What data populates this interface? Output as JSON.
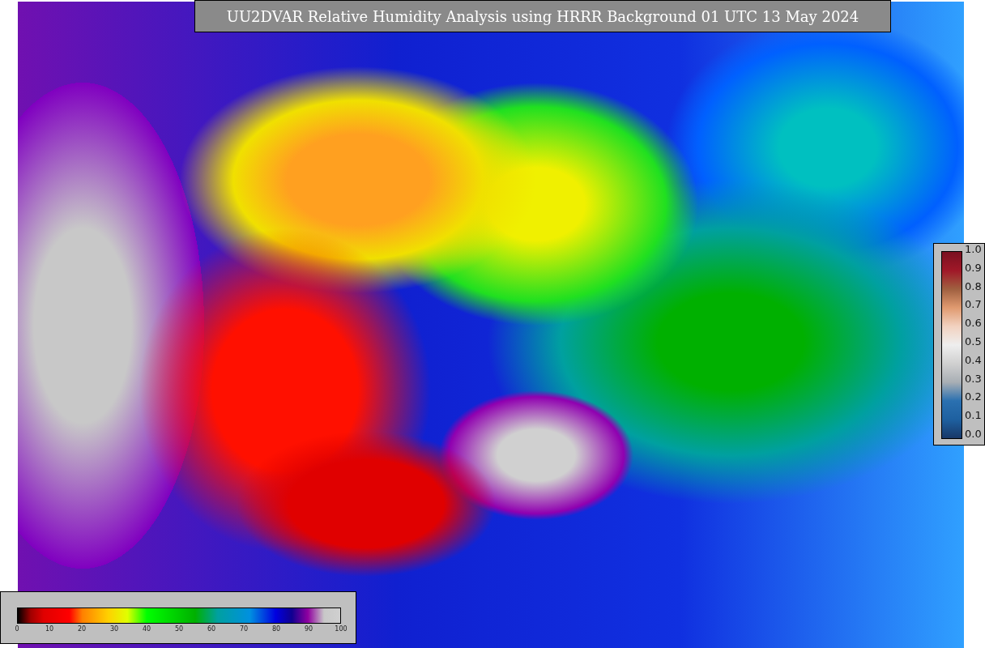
{
  "title": "UU2DVAR Relative Humidity Analysis using HRRR Background 01 UTC 13 May 2024",
  "humidity_legend": {
    "ticks": [
      "0",
      "10",
      "20",
      "30",
      "40",
      "50",
      "60",
      "70",
      "80",
      "90",
      "100"
    ]
  },
  "ratio_legend": {
    "ticks": [
      "1.0",
      "0.9",
      "0.8",
      "0.7",
      "0.6",
      "0.5",
      "0.4",
      "0.3",
      "0.2",
      "0.1",
      "0.0"
    ]
  }
}
